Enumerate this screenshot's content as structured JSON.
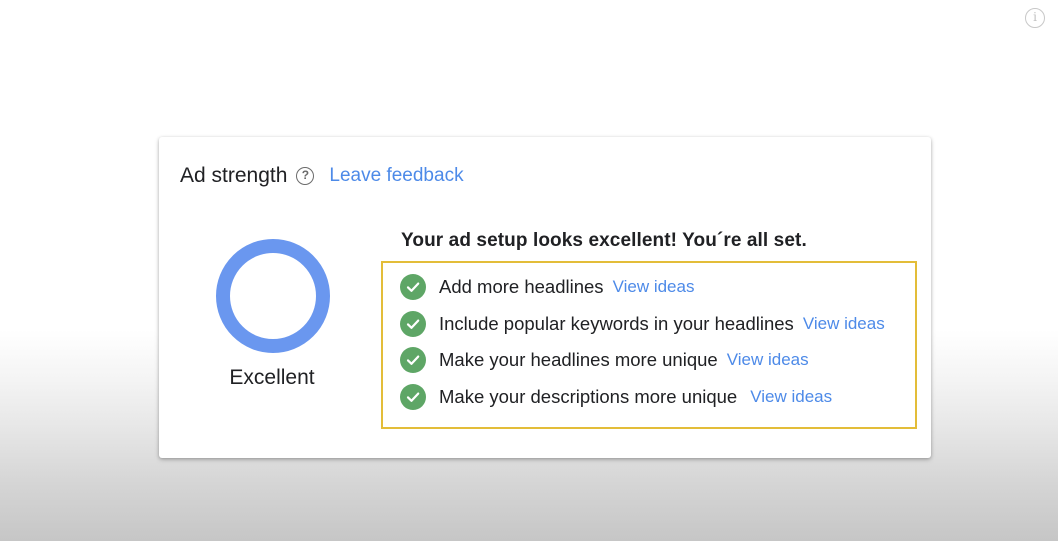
{
  "colors": {
    "accent_link": "#4d8ae8",
    "ring": "#6a97ef",
    "check": "#5ea666",
    "highlight_border": "#e3bd39"
  },
  "info_icon": "info-icon",
  "ad_strength": {
    "title": "Ad strength",
    "help_icon": "question-mark-icon",
    "feedback_label": "Leave feedback",
    "rating": "Excellent",
    "summary": "Your ad setup looks excellent! You´re all set.",
    "suggestions": [
      {
        "text": "Add more headlines",
        "link": "View ideas",
        "status": "done"
      },
      {
        "text": "Include popular keywords in your headlines",
        "link": "View ideas",
        "status": "done"
      },
      {
        "text": "Make your headlines more unique",
        "link": "View ideas",
        "status": "done"
      },
      {
        "text": "Make your descriptions more unique",
        "link": "View ideas",
        "status": "done"
      }
    ]
  }
}
